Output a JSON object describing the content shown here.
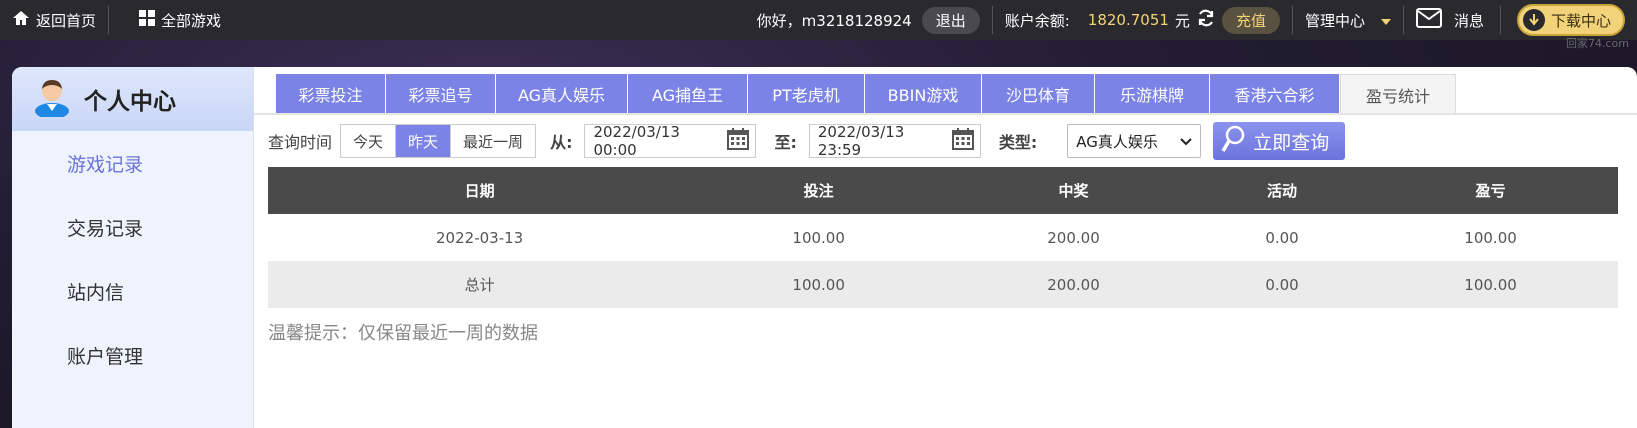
{
  "topbar": {
    "home_label": "返回首页",
    "all_games_label": "全部游戏",
    "greeting": "你好，m3218128924",
    "logout_label": "退出",
    "balance_label": "账户余额:",
    "balance_value": "1820.7051",
    "balance_unit": "元",
    "recharge_label": "充值",
    "manage_label": "管理中心",
    "messages_label": "消息",
    "download_label": "下载中心",
    "watermark": "回家74.com"
  },
  "sidebar": {
    "title": "个人中心",
    "items": [
      {
        "label": "游戏记录",
        "active": true
      },
      {
        "label": "交易记录",
        "active": false
      },
      {
        "label": "站内信",
        "active": false
      },
      {
        "label": "账户管理",
        "active": false
      }
    ]
  },
  "tabs": [
    {
      "label": "彩票投注"
    },
    {
      "label": "彩票追号"
    },
    {
      "label": "AG真人娱乐"
    },
    {
      "label": "AG捕鱼王"
    },
    {
      "label": "PT老虎机"
    },
    {
      "label": "BBIN游戏"
    },
    {
      "label": "沙巴体育"
    },
    {
      "label": "乐游棋牌"
    },
    {
      "label": "香港六合彩"
    },
    {
      "label": "盈亏统计",
      "active": true
    }
  ],
  "filter": {
    "query_time_label": "查询时间",
    "range_options": [
      "今天",
      "昨天",
      "最近一周"
    ],
    "selected_range": "昨天",
    "from_label": "从:",
    "from_value": "2022/03/13 00:00",
    "to_label": "至:",
    "to_value": "2022/03/13 23:59",
    "type_label": "类型:",
    "type_value": "AG真人娱乐",
    "query_button": "立即查询"
  },
  "table": {
    "headers": [
      "日期",
      "投注",
      "中奖",
      "活动",
      "盈亏"
    ],
    "rows": [
      [
        "2022-03-13",
        "100.00",
        "200.00",
        "0.00",
        "100.00"
      ],
      [
        "总计",
        "100.00",
        "200.00",
        "0.00",
        "100.00"
      ]
    ]
  },
  "tip": "温馨提示：仅保留最近一周的数据",
  "colors": {
    "accent": "#7b83e6",
    "gold": "#f3d37a",
    "header_bg": "#4a4a4a"
  }
}
